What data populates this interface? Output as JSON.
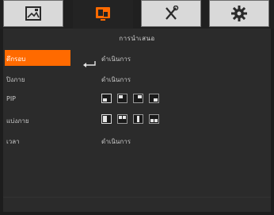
{
  "tabs": [
    {
      "icon": "image-icon",
      "active": false
    },
    {
      "icon": "output-monitor-icon",
      "active": true
    },
    {
      "icon": "tools-icon",
      "active": false
    },
    {
      "icon": "gear-icon",
      "active": false
    }
  ],
  "menu": {
    "heading": "การนำเสนอ",
    "rows": [
      {
        "label": "ดึกรอบ",
        "value": "ดำเนินการ",
        "selected": true
      },
      {
        "label": "ปิงภาย",
        "value": "ดำเนินการ",
        "selected": false
      },
      {
        "label": "PIP",
        "value": "",
        "selected": false
      },
      {
        "label": "แบ่งภาย",
        "value": "",
        "selected": false
      },
      {
        "label": "เวลา",
        "value": "ดำเนินการ",
        "selected": false
      }
    ]
  },
  "colors": {
    "accent": "#ff6a00",
    "tab_inactive": "#d9d9d9",
    "panel": "#2b2b2b"
  }
}
